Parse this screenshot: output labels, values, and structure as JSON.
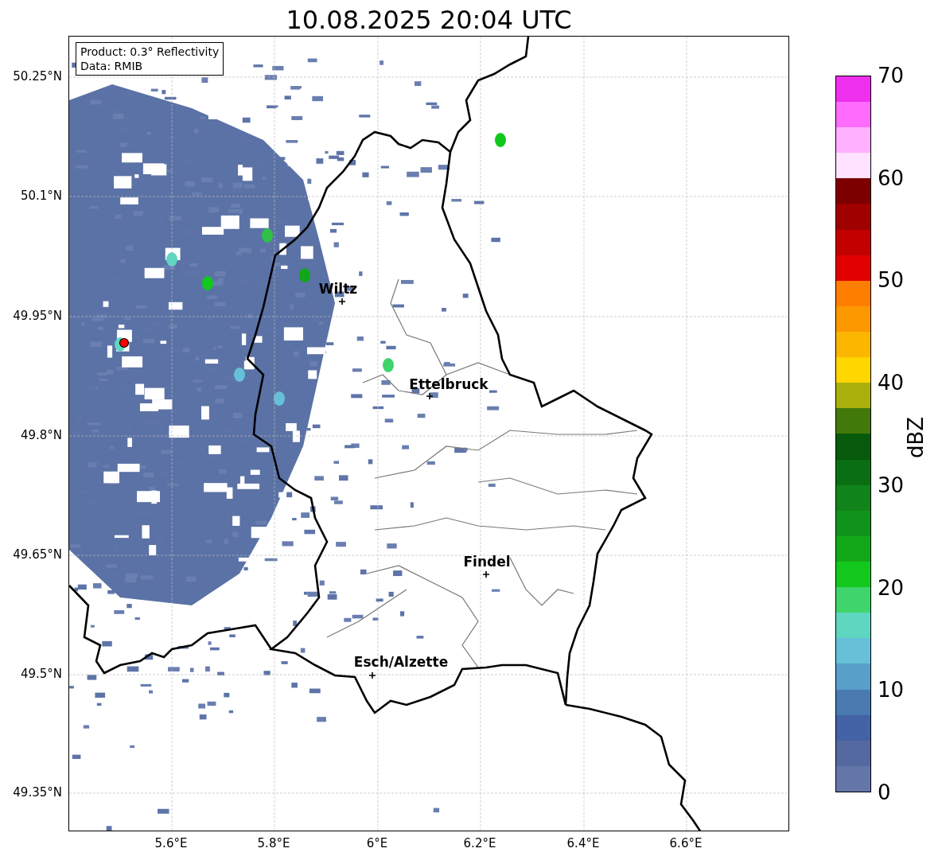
{
  "title": "10.08.2025 20:04 UTC",
  "info_box": [
    "Product: 0.3° Reflectivity",
    "Data: RMIB"
  ],
  "map": {
    "lat_ticks": [
      "50.25°N",
      "50.1°N",
      "49.95°N",
      "49.8°N",
      "49.65°N",
      "49.5°N",
      "49.35°N"
    ],
    "lon_ticks": [
      "5.6°E",
      "5.8°E",
      "6°E",
      "6.2°E",
      "6.4°E",
      "6.6°E"
    ],
    "cities": [
      {
        "name": "Wiltz"
      },
      {
        "name": "Ettelbruck"
      },
      {
        "name": "Findel"
      },
      {
        "name": "Esch/Alzette"
      }
    ]
  },
  "colorbar": {
    "label": "dBZ",
    "ticks": [
      "70",
      "60",
      "50",
      "40",
      "30",
      "20",
      "10",
      "0"
    ],
    "segments": [
      {
        "color": "#6476a8"
      },
      {
        "color": "#54699f"
      },
      {
        "color": "#4462a6"
      },
      {
        "color": "#4a7ab0"
      },
      {
        "color": "#589fca"
      },
      {
        "color": "#65c0d8"
      },
      {
        "color": "#5fd6c0"
      },
      {
        "color": "#3fd46c"
      },
      {
        "color": "#12c81c"
      },
      {
        "color": "#13a818"
      },
      {
        "color": "#10931a"
      },
      {
        "color": "#10831a"
      },
      {
        "color": "#0a6f12"
      },
      {
        "color": "#075a0c"
      },
      {
        "color": "#417a0a"
      },
      {
        "color": "#aab00b"
      },
      {
        "color": "#fed600"
      },
      {
        "color": "#fdb600"
      },
      {
        "color": "#fd9800"
      },
      {
        "color": "#fe7f00"
      },
      {
        "color": "#e30000"
      },
      {
        "color": "#c20000"
      },
      {
        "color": "#a00000"
      },
      {
        "color": "#7c0000"
      },
      {
        "color": "#ffe2ff"
      },
      {
        "color": "#ffb1ff"
      },
      {
        "color": "#fd6cfd"
      },
      {
        "color": "#ee2fee"
      }
    ]
  }
}
